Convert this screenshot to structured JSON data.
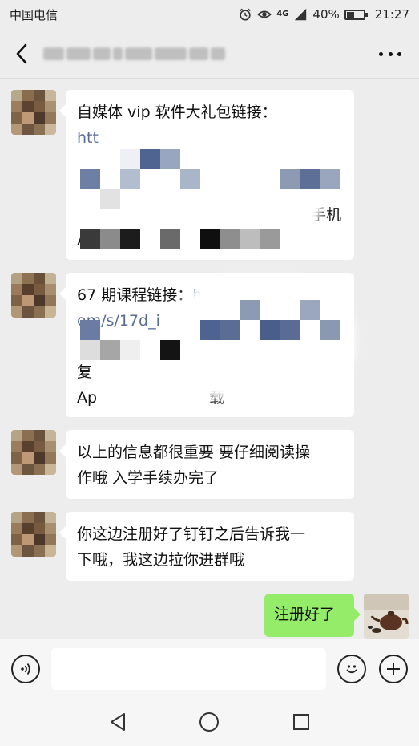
{
  "status_bar": {
    "carrier": "中国电信",
    "network": "4G",
    "battery": "40%",
    "time": "21:27"
  },
  "header": {
    "back_icon": "chevron-left-icon",
    "more_icon": "more-dots-icon"
  },
  "messages": [
    {
      "from": "contact",
      "lines": [
        "自媒体 vip 软件大礼包链接："
      ],
      "partial": [
        "htt",
        "手机",
        "App，"
      ]
    },
    {
      "from": "contact",
      "lines": [
        "67 期课程链接："
      ],
      "partial": [
        "h",
        "om/s/17d_i",
        "复",
        "Ap",
        "载"
      ]
    },
    {
      "from": "contact",
      "lines": [
        "以上的信息都很重要  要仔细阅读操",
        "作哦  入学手续办完了"
      ]
    },
    {
      "from": "contact",
      "lines": [
        "你这边注册好了钉钉之后告诉我一",
        "下哦，我这边拉你进群哦"
      ]
    },
    {
      "from": "me",
      "lines": [
        "注册好了"
      ]
    }
  ],
  "input_bar": {
    "voice_icon": "voice-icon",
    "emoji_icon": "emoji-icon",
    "plus_icon": "plus-icon",
    "value": ""
  },
  "colors": {
    "background": "#ededed",
    "my_bubble": "#95ec69",
    "their_bubble": "#ffffff",
    "link": "#576b95"
  }
}
